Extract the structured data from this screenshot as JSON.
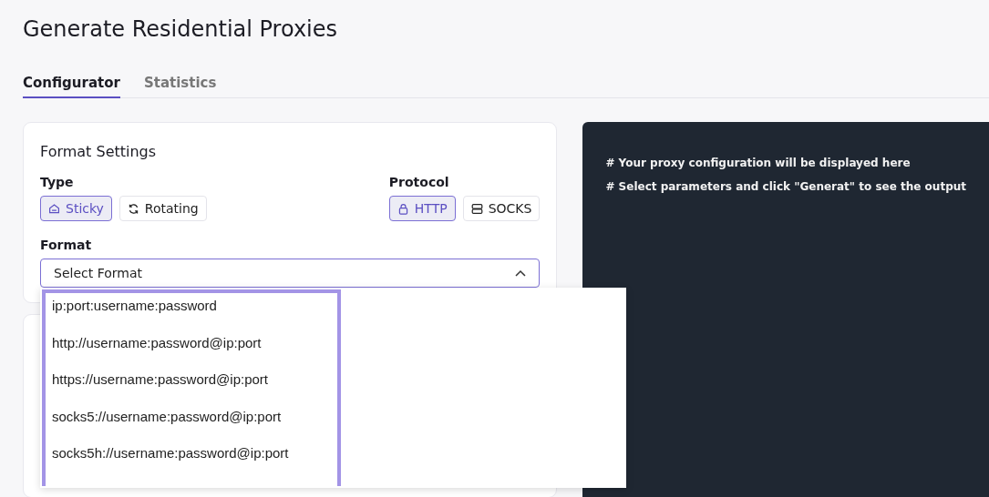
{
  "page": {
    "title": "Generate Residential Proxies"
  },
  "tabs": [
    {
      "label": "Configurator",
      "selected": true
    },
    {
      "label": "Statistics",
      "selected": false
    }
  ],
  "format_settings": {
    "title": "Format Settings",
    "type": {
      "label": "Type",
      "options": [
        {
          "label": "Sticky",
          "selected": true
        },
        {
          "label": "Rotating",
          "selected": false
        }
      ]
    },
    "protocol": {
      "label": "Protocol",
      "options": [
        {
          "label": "HTTP",
          "selected": true
        },
        {
          "label": "SOCKS",
          "selected": false
        }
      ]
    },
    "format": {
      "label": "Format",
      "placeholder": "Select Format",
      "expanded": true,
      "options": [
        "ip:port:username:password",
        "http://username:password@ip:port",
        "https://username:password@ip:port",
        "socks5://username:password@ip:port",
        "socks5h://username:password@ip:port"
      ]
    }
  },
  "output": {
    "lines": [
      "# Your proxy configuration will be displayed here",
      "# Select parameters and click \"Generat\" to see the output"
    ]
  }
}
